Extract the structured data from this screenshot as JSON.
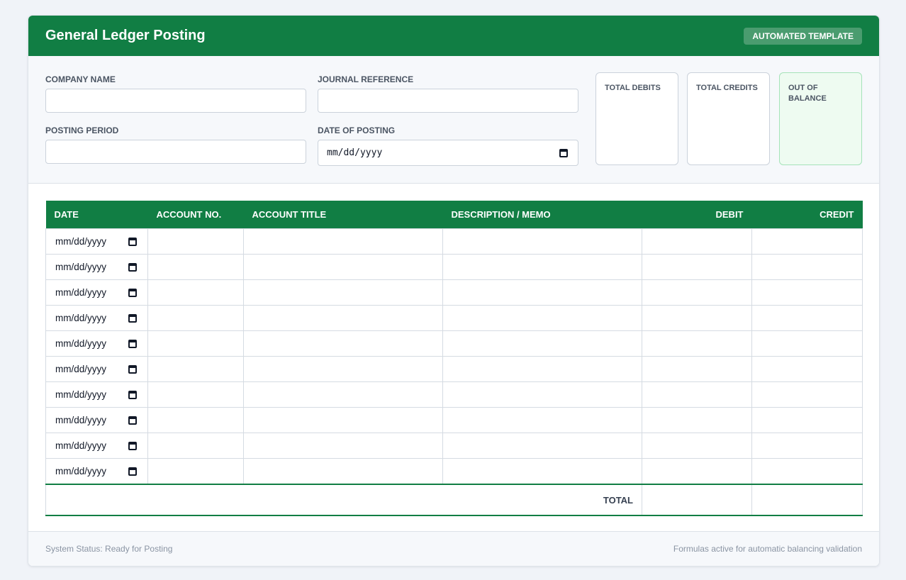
{
  "header": {
    "title": "General Ledger Posting",
    "badge": "AUTOMATED TEMPLATE"
  },
  "form": {
    "company_name": {
      "label": "COMPANY NAME",
      "value": ""
    },
    "journal_reference": {
      "label": "JOURNAL REFERENCE",
      "value": ""
    },
    "posting_period": {
      "label": "POSTING PERIOD",
      "value": ""
    },
    "date_of_posting": {
      "label": "DATE OF POSTING",
      "placeholder": "mm/dd/yyyy"
    }
  },
  "summary": {
    "total_debits": "TOTAL DEBITS",
    "total_credits": "TOTAL CREDITS",
    "out_of_balance": "OUT OF BALANCE"
  },
  "table": {
    "columns": [
      "DATE",
      "ACCOUNT NO.",
      "ACCOUNT TITLE",
      "DESCRIPTION / MEMO",
      "DEBIT",
      "CREDIT"
    ],
    "date_placeholder": "mm/dd/yyyy",
    "row_count": 10,
    "total_label": "TOTAL"
  },
  "footer": {
    "status": "System Status: Ready for Posting",
    "note": "Formulas active for automatic balancing validation"
  },
  "colors": {
    "brand": "#117e44",
    "balance_bg": "#eefbf1"
  }
}
